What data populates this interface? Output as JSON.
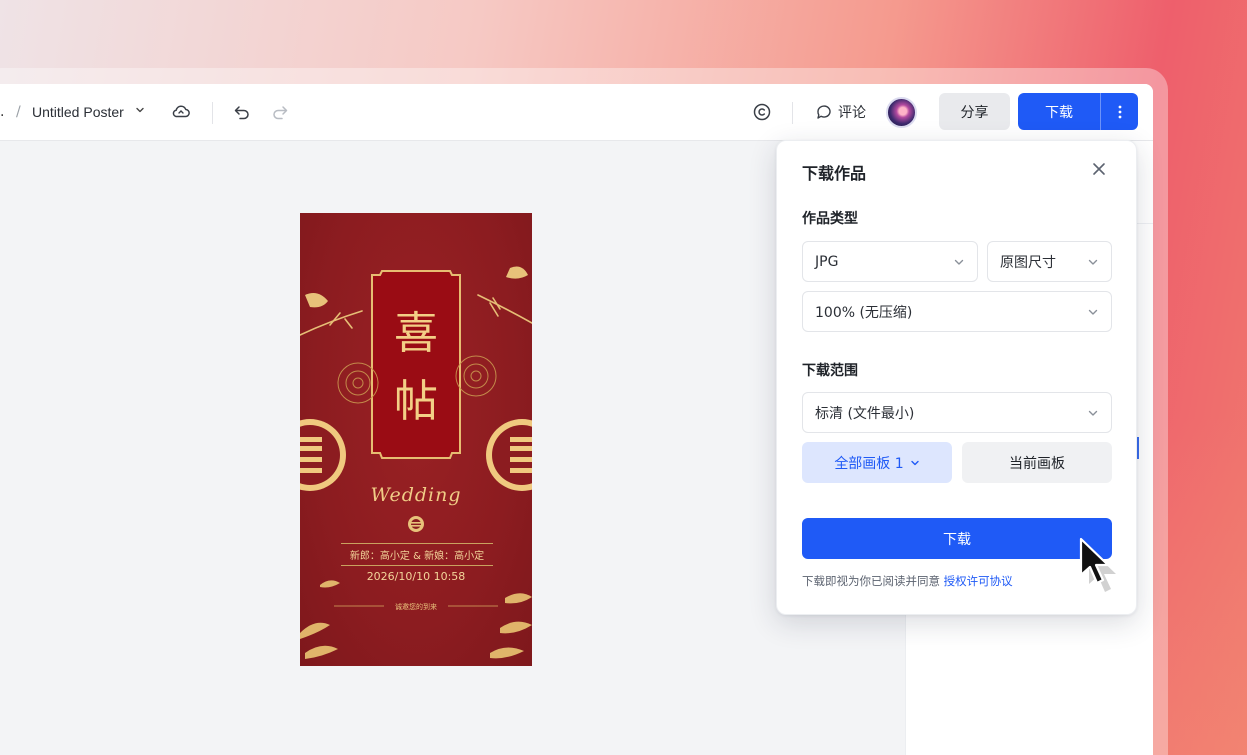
{
  "toolbar": {
    "breadcrumb_prefix": ".",
    "separator": "/",
    "doc_title": "Untitled Poster",
    "comment_label": "评论",
    "share_label": "分享",
    "download_label": "下载"
  },
  "poster": {
    "char1": "喜",
    "char2": "帖",
    "wedding": "Wedding",
    "names": "新郎：高小定 & 新娘：高小定",
    "datetime": "2026/10/10 10:58",
    "invite": "诚邀您的到来"
  },
  "download_panel": {
    "title": "下载作品",
    "type_label": "作品类型",
    "format_value": "JPG",
    "size_value": "原图尺寸",
    "quality_value": "100% (无压缩)",
    "range_label": "下载范围",
    "resolution_value": "标清 (文件最小)",
    "all_boards_label": "全部画板 1",
    "current_board_label": "当前画板",
    "download_button": "下载",
    "agreement_text": "下载即视为你已阅读并同意",
    "agreement_link": "授权许可协议"
  },
  "colors": {
    "accent": "#1f5af6",
    "poster_red": "#8c1c20",
    "poster_gold": "#f3cf86"
  }
}
